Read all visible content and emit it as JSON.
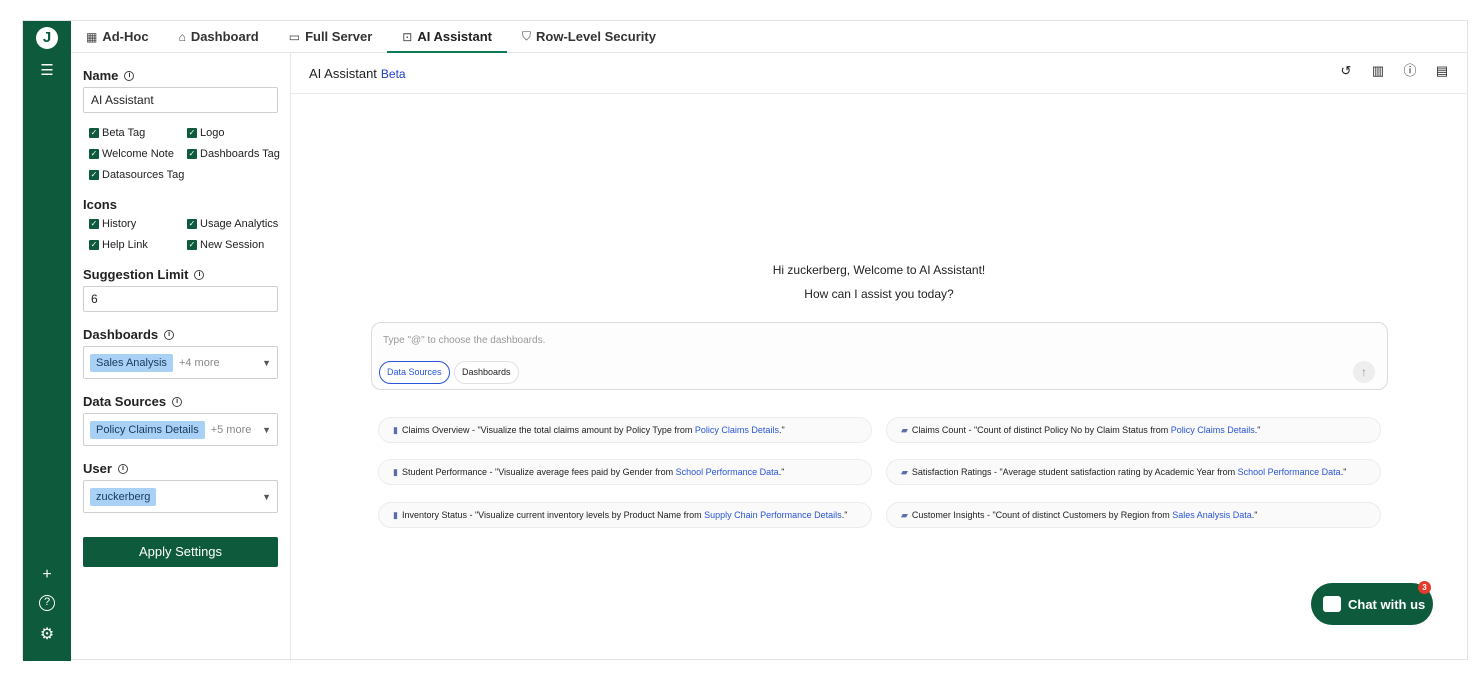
{
  "rail": {
    "logo": "J",
    "menu_icon": "hamburger-icon",
    "bottom_icons": [
      "plus-icon",
      "help-icon",
      "gear-icon"
    ]
  },
  "tabs": [
    {
      "label": "Ad-Hoc",
      "icon": "grid-icon"
    },
    {
      "label": "Dashboard",
      "icon": "home-icon"
    },
    {
      "label": "Full Server",
      "icon": "monitor-icon"
    },
    {
      "label": "AI Assistant",
      "icon": "robot-icon",
      "active": true
    },
    {
      "label": "Row-Level Security",
      "icon": "shield-icon"
    }
  ],
  "settings": {
    "name_label": "Name",
    "name_value": "AI Assistant",
    "checks_1": [
      {
        "label": "Beta Tag"
      },
      {
        "label": "Logo"
      },
      {
        "label": "Welcome Note"
      },
      {
        "label": "Dashboards Tag"
      },
      {
        "label": "Datasources Tag"
      }
    ],
    "icons_label": "Icons",
    "checks_2": [
      {
        "label": "History"
      },
      {
        "label": "Usage Analytics"
      },
      {
        "label": "Help Link"
      },
      {
        "label": "New Session"
      }
    ],
    "suggestion_limit_label": "Suggestion Limit",
    "suggestion_limit_value": "6",
    "dashboards_label": "Dashboards",
    "dashboards_chip": "Sales Analysis",
    "dashboards_more": "+4 more",
    "datasources_label": "Data Sources",
    "datasources_chip": "Policy Claims Details",
    "datasources_more": "+5 more",
    "user_label": "User",
    "user_chip": "zuckerberg",
    "apply_label": "Apply Settings"
  },
  "main": {
    "title": "AI Assistant",
    "beta": "Beta",
    "header_icons": [
      "history-icon",
      "analytics-icon",
      "help-icon",
      "new-session-icon"
    ],
    "welcome_line1": "Hi zuckerberg, Welcome to AI Assistant!",
    "welcome_line2": "How can I assist you today?",
    "prompt_placeholder": "Type \"@\" to choose the dashboards.",
    "pill_datasources": "Data Sources",
    "pill_dashboards": "Dashboards",
    "suggestions": [
      {
        "text": "Claims Overview - \"Visualize the total claims amount by Policy Type from ",
        "link": "Policy Claims Details",
        "end": ".\""
      },
      {
        "text": "Claims Count - \"Count of distinct Policy No by Claim Status from ",
        "link": "Policy Claims Details",
        "end": ".\""
      },
      {
        "text": "Student Performance - \"Visualize average fees paid by Gender from ",
        "link": "School Performance Data",
        "end": ".\""
      },
      {
        "text": "Satisfaction Ratings - \"Average student satisfaction rating by Academic Year from ",
        "link": "School Performance Data",
        "end": ".\""
      },
      {
        "text": "Inventory Status - \"Visualize current inventory levels by Product Name from ",
        "link": "Supply Chain Performance Details",
        "end": ".\""
      },
      {
        "text": "Customer Insights - \"Count of distinct Customers by Region from ",
        "link": "Sales Analysis Data",
        "end": ".\""
      }
    ]
  },
  "chat": {
    "label": "Chat with us",
    "badge": "3"
  }
}
